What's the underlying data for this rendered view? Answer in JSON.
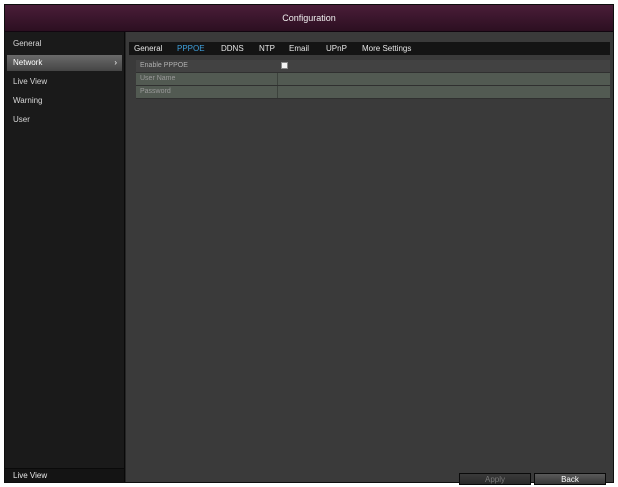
{
  "window": {
    "title": "Configuration"
  },
  "sidebar": {
    "items": [
      {
        "label": "General",
        "active": false
      },
      {
        "label": "Network",
        "active": true,
        "chevron": "›"
      },
      {
        "label": "Live View",
        "active": false
      },
      {
        "label": "Warning",
        "active": false
      },
      {
        "label": "User",
        "active": false
      }
    ],
    "footer": "Live View"
  },
  "tabs": [
    {
      "label": "General"
    },
    {
      "label": "PPPOE",
      "active": true
    },
    {
      "label": "DDNS"
    },
    {
      "label": "NTP"
    },
    {
      "label": "Email"
    },
    {
      "label": "UPnP"
    },
    {
      "label": "More Settings"
    }
  ],
  "form": {
    "enable_label": "Enable PPPOE",
    "enable_checked": false,
    "user_name_label": "User Name",
    "user_name_value": "",
    "password_label": "Password",
    "password_value": ""
  },
  "buttons": {
    "apply": "Apply",
    "back": "Back"
  },
  "colors": {
    "titlebar": "#3c1530",
    "active_tab": "#3fa0dc",
    "input_row": "#525a52"
  }
}
